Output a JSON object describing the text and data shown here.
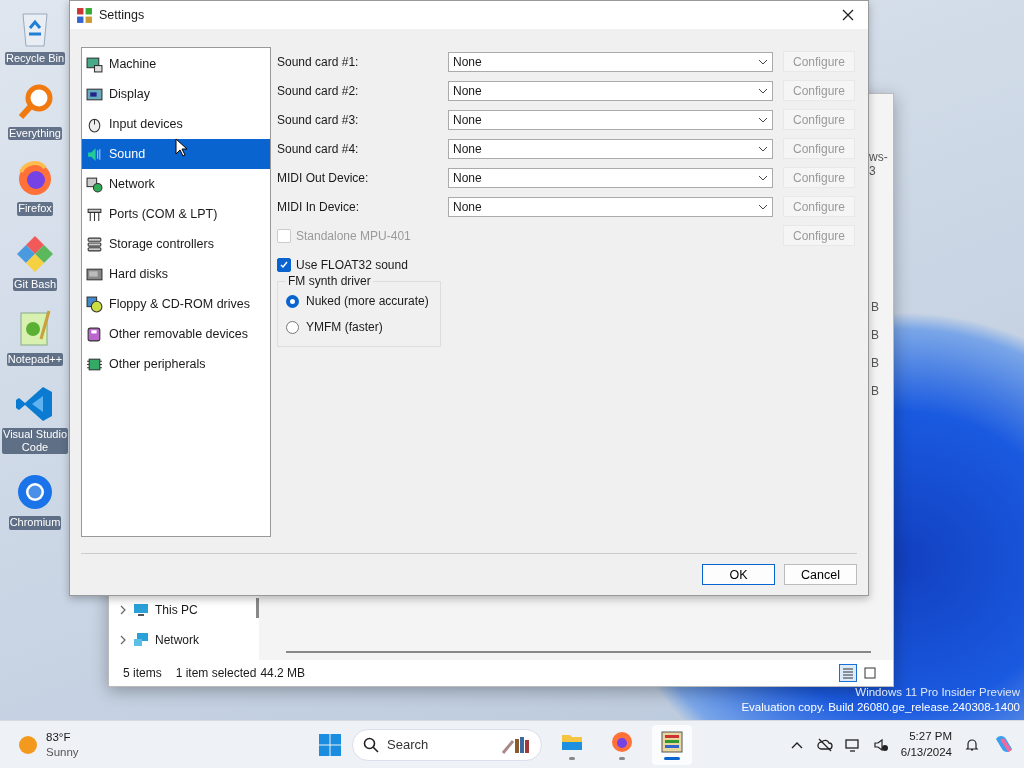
{
  "desktop_icons": [
    {
      "label": "Recycle Bin",
      "kind": "bin"
    },
    {
      "label": "Everything",
      "kind": "search"
    },
    {
      "label": "Firefox",
      "kind": "firefox"
    },
    {
      "label": "Git Bash",
      "kind": "git"
    },
    {
      "label": "Notepad++",
      "kind": "notepad"
    },
    {
      "label": "Visual Studio Code",
      "kind": "vscode"
    },
    {
      "label": "Chromium",
      "kind": "chromium"
    }
  ],
  "explorer": {
    "header_fragment": "ws-3",
    "size_fragments": [
      "B",
      "B",
      "B",
      "B"
    ],
    "nav_items": [
      {
        "label": "This PC",
        "kind": "pc"
      },
      {
        "label": "Network",
        "kind": "network"
      }
    ],
    "status": {
      "count": "5 items",
      "selection": "1 item selected",
      "size": "44.2 MB"
    },
    "views": [
      {
        "kind": "details",
        "selected": true
      },
      {
        "kind": "tiles",
        "selected": false
      }
    ]
  },
  "dialog": {
    "title": "Settings",
    "categories": [
      {
        "label": "Machine",
        "kind": "machine",
        "selected": false
      },
      {
        "label": "Display",
        "kind": "display",
        "selected": false
      },
      {
        "label": "Input devices",
        "kind": "input",
        "selected": false
      },
      {
        "label": "Sound",
        "kind": "sound",
        "selected": true
      },
      {
        "label": "Network",
        "kind": "network",
        "selected": false
      },
      {
        "label": "Ports (COM & LPT)",
        "kind": "ports",
        "selected": false
      },
      {
        "label": "Storage controllers",
        "kind": "storage",
        "selected": false
      },
      {
        "label": "Hard disks",
        "kind": "hdd",
        "selected": false
      },
      {
        "label": "Floppy & CD-ROM drives",
        "kind": "floppy",
        "selected": false
      },
      {
        "label": "Other removable devices",
        "kind": "removable",
        "selected": false
      },
      {
        "label": "Other peripherals",
        "kind": "peripherals",
        "selected": false
      }
    ],
    "devices": [
      {
        "label": "Sound card #1:",
        "value": "None",
        "button": "Configure",
        "button_disabled": true
      },
      {
        "label": "Sound card #2:",
        "value": "None",
        "button": "Configure",
        "button_disabled": true
      },
      {
        "label": "Sound card #3:",
        "value": "None",
        "button": "Configure",
        "button_disabled": true
      },
      {
        "label": "Sound card #4:",
        "value": "None",
        "button": "Configure",
        "button_disabled": true
      },
      {
        "label": "MIDI Out Device:",
        "value": "None",
        "button": "Configure",
        "button_disabled": true
      },
      {
        "label": "MIDI In Device:",
        "value": "None",
        "button": "Configure",
        "button_disabled": true
      }
    ],
    "mpu": {
      "label": "Standalone MPU-401",
      "checked": false,
      "disabled": true,
      "button": "Configure",
      "button_disabled": true
    },
    "float32": {
      "label": "Use FLOAT32 sound",
      "checked": true,
      "disabled": false
    },
    "fm_group": {
      "title": "FM synth driver",
      "options": [
        {
          "label": "Nuked (more accurate)",
          "selected": true
        },
        {
          "label": "YMFM (faster)",
          "selected": false
        }
      ]
    },
    "buttons": [
      {
        "label": "OK",
        "default": true
      },
      {
        "label": "Cancel",
        "default": false
      }
    ]
  },
  "watermark": [
    "Windows 11 Pro Insider Preview",
    "Evaluation copy. Build 26080.ge_release.240308-1400"
  ],
  "taskbar": {
    "weather": {
      "temperature": "83°F",
      "condition": "Sunny"
    },
    "search": {
      "placeholder": "Search"
    },
    "apps": [
      {
        "kind": "explorer",
        "running": true,
        "focused": false
      },
      {
        "kind": "firefox",
        "running": true,
        "focused": false
      },
      {
        "kind": "emulator",
        "running": true,
        "focused": true
      }
    ],
    "clock": {
      "time": "5:27 PM",
      "date": "6/13/2024"
    }
  }
}
